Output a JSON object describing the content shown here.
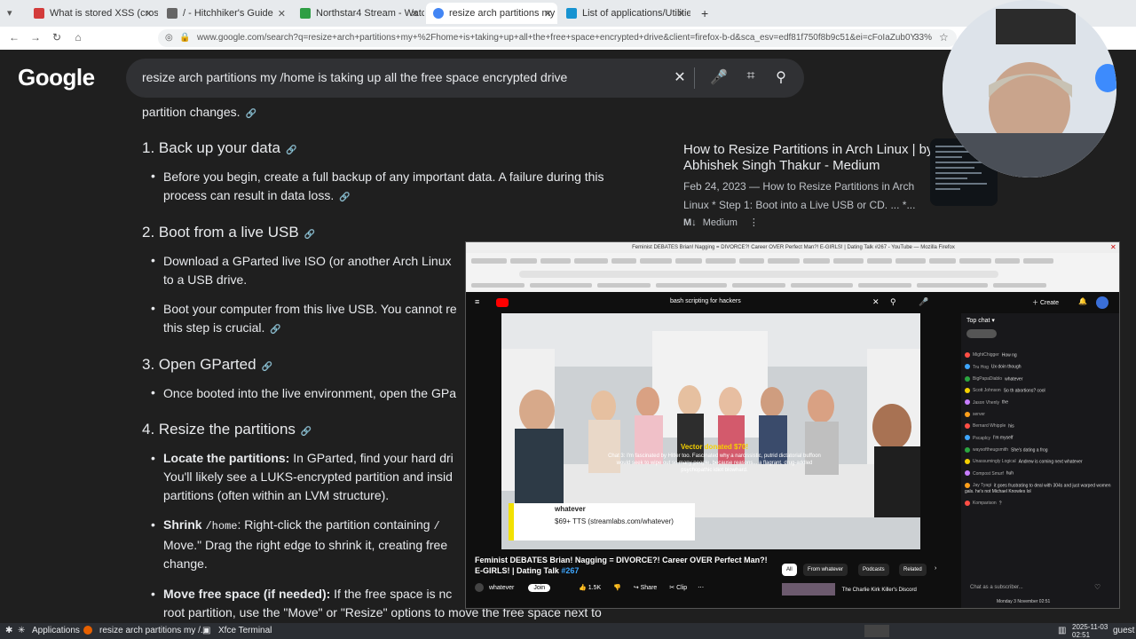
{
  "browser": {
    "tabs": [
      {
        "label": "What is stored XSS (cross-s",
        "color": "#d33b3b"
      },
      {
        "label": "/ - Hitchhiker's Guide",
        "color": "#666666"
      },
      {
        "label": "Northstar4 Stream - Watch",
        "color": "#2e9e44"
      },
      {
        "label": "resize arch partitions my /h",
        "color": "#4285f4"
      },
      {
        "label": "List of applications/Utilities",
        "color": "#1793d1"
      }
    ],
    "new_tab_label": "+",
    "url": "www.google.com/search?q=resize+arch+partitions+my+%2Fhome+is+taking+up+all+the+free+space+encrypted+drive&client=firefox-b-d&sca_esv=edf81f750f8b9c51&ei=cFoIaZub0Y",
    "zoom": "33%"
  },
  "google": {
    "logo": "Google",
    "query": "resize arch partitions my /home is taking up all the free space encrypted drive",
    "intro_tail": "partition changes.",
    "steps": [
      {
        "heading": "1. Back up your data",
        "bullets": [
          {
            "bold": "",
            "text": "Before you begin, create a full backup of any important data. A failure during this",
            "text2": "process can result in data loss."
          }
        ]
      },
      {
        "heading": "2. Boot from a live USB",
        "bullets": [
          {
            "bold": "",
            "text": "Download a GParted live ISO (or another Arch Linux",
            "text2": "to a USB drive."
          },
          {
            "bold": "",
            "text": "Boot your computer from this live USB. You cannot re",
            "text2": "this step is crucial."
          }
        ]
      },
      {
        "heading": "3. Open GParted",
        "bullets": [
          {
            "bold": "",
            "text": "Once booted into the live environment, open the GPa",
            "text2": ""
          }
        ]
      },
      {
        "heading": "4. Resize the partitions",
        "bullets": [
          {
            "bold": "Locate the partitions:",
            "text": " In GParted, find your hard dri",
            "text2": "You'll likely see a LUKS-encrypted partition and insid",
            "text3": "partitions (often within an LVM structure)."
          },
          {
            "bold": "Shrink",
            "code": "/home",
            "text": ": Right-click the partition containing",
            "code2": "/",
            "text2": "Move.\" Drag the right edge to shrink it, creating free",
            "text3": "change."
          },
          {
            "bold": "Move free space (if needed):",
            "text": " If the free space is nc",
            "text2": "root partition, use the \"Move\" or \"Resize\" options to move the free space next to"
          }
        ]
      }
    ],
    "card": {
      "title": "How to Resize Partitions in Arch Linux | by Abhishek Singh Thakur - Medium",
      "desc": "Feb 24, 2023 — How to Resize Partitions in Arch Linux * Step 1: Boot into a Live USB or CD. ... *...",
      "source": "Medium",
      "source_badge": "M↓"
    }
  },
  "youtube": {
    "window_title": "Feminist DEBATES Brian! Nagging = DIVORCE?! Career OVER Perfect Man?! E-GIRLS! | Dating Talk #267 - YouTube — Mozilla Firefox",
    "search_query": "bash scripting for hackers",
    "create_label": "Create",
    "video_title": "Feminist DEBATES Brian! Nagging = DIVORCE?! Career OVER Perfect Man?! E-GIRLS! | Dating Talk",
    "video_title_num": "#267",
    "donation_header": "Vector donated $70!",
    "donation_text": "Chat 3: I'm fascinated by Hitler too. Fascinated why a narcissistic, putrid dictatorial buffoon would seek to wipe out so many people, because reasons... a flagrant, drug-addled psychopathic idiot blowhard.",
    "tts_name": "whatever",
    "tts_text": "$69+ TTS (streamlabs.com/whatever)",
    "channel": "whatever",
    "join_label": "Join",
    "likes": "1.5K",
    "share_label": "Share",
    "clip_label": "Clip",
    "chips": [
      "All",
      "From whatever",
      "Podcasts",
      "Related"
    ],
    "related_title": "The Charlie Kirk Killer's Discord",
    "chat_header": "Top chat",
    "chat_messages": [
      {
        "user": "MightChigger",
        "text": "How ng"
      },
      {
        "user": "Tru Hog",
        "text": "Ux doin though"
      },
      {
        "user": "BigPapaDiablo",
        "text": "whatever"
      },
      {
        "user": "Scott Johnson",
        "text": "So th abortions? cool"
      },
      {
        "user": "Jason Vhenly",
        "text": "the"
      },
      {
        "user": "server",
        "text": ""
      },
      {
        "user": "Bernard Whipple",
        "text": "his"
      },
      {
        "user": "Pscaplcy",
        "text": "I'm myself"
      },
      {
        "user": "waysoftheugsmith",
        "text": "She's dating a frog"
      },
      {
        "user": "Unassumingly Logical",
        "text": "Andrew is coming next whatever"
      },
      {
        "user": "Compost Smurf",
        "text": "huh"
      },
      {
        "user": "Jay Tyagi",
        "text": "it goes frustrating to deal with 304s and just warped women gals. he's not Michael Knowles lol"
      },
      {
        "user": "Komparison",
        "text": "?"
      }
    ],
    "chat_input_placeholder": "Chat as a subscriber...",
    "status_time": "Monday 3 November 02:51"
  },
  "taskbar": {
    "apps_label": "Applications",
    "item1": "resize arch partitions my /...",
    "item2": "Xfce Terminal",
    "date": "2025-11-03",
    "time": "02:51",
    "user": "guest"
  }
}
